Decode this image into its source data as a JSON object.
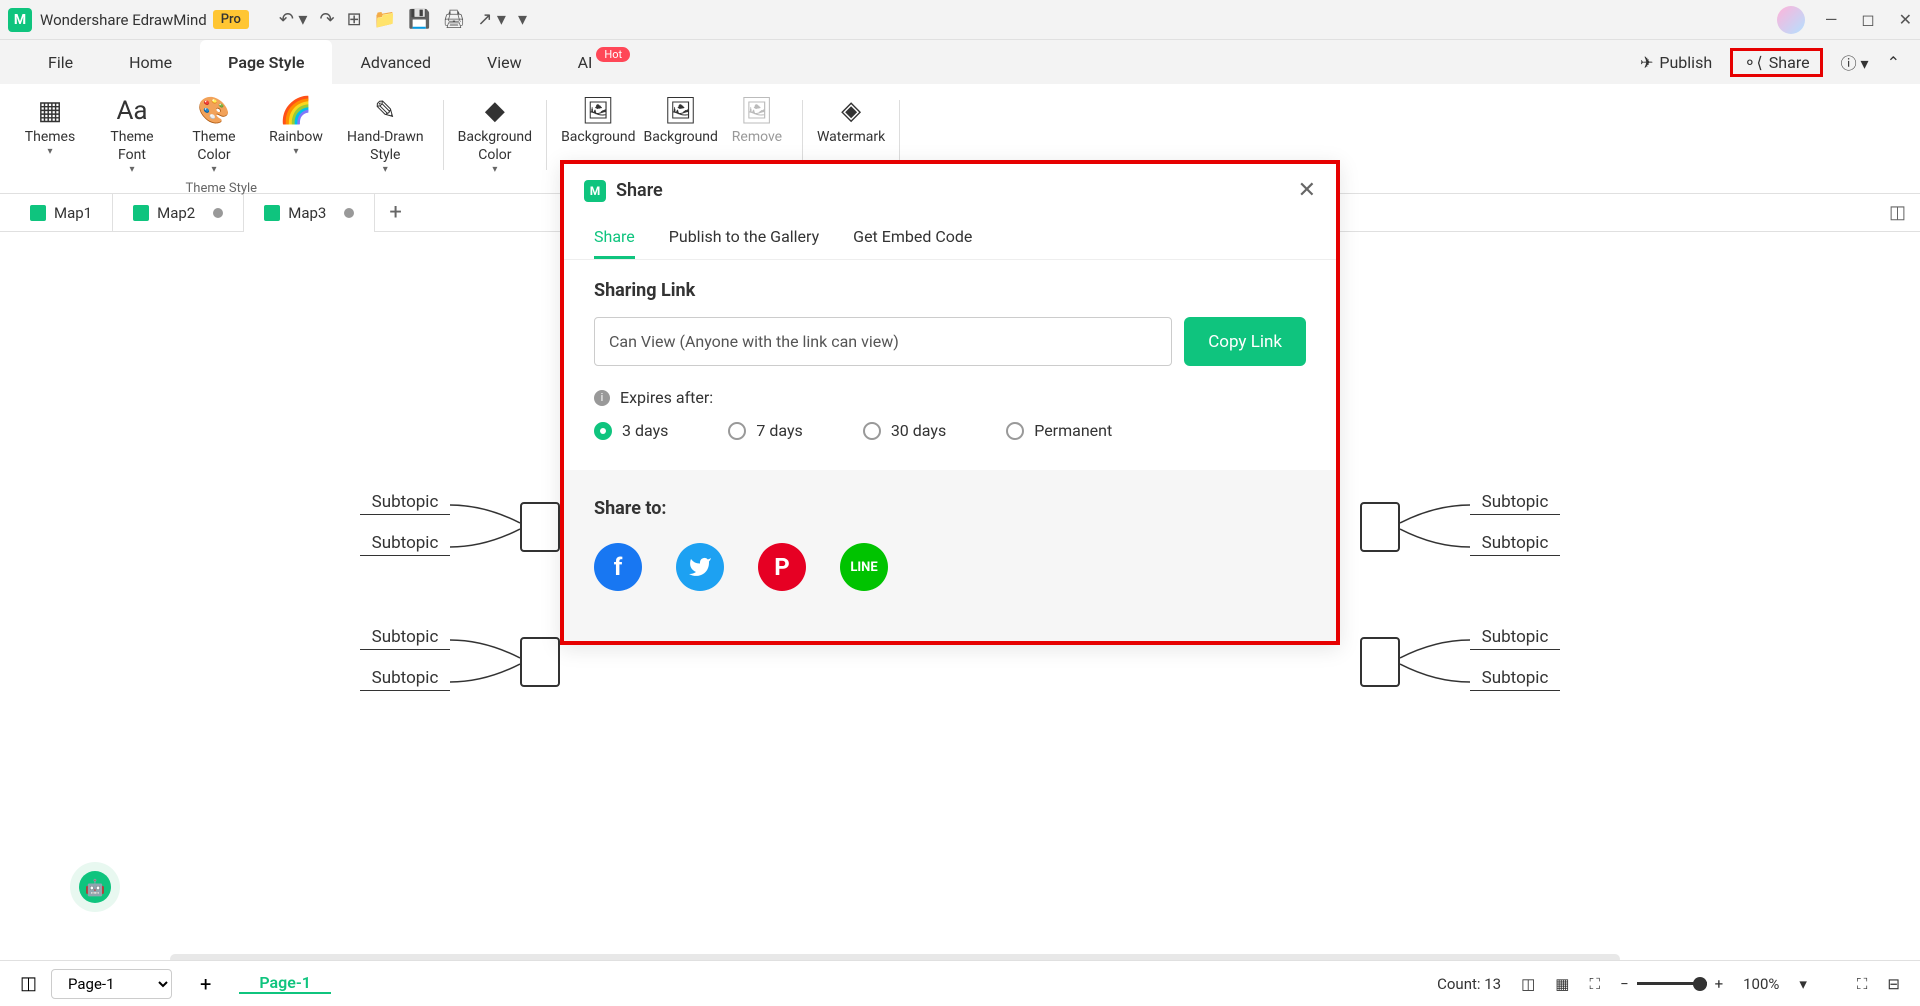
{
  "app": {
    "title": "Wondershare EdrawMind",
    "pro": "Pro"
  },
  "menus": {
    "file": "File",
    "home": "Home",
    "pageStyle": "Page Style",
    "advanced": "Advanced",
    "view": "View",
    "ai": "AI",
    "hot": "Hot",
    "publish": "Publish",
    "share": "Share"
  },
  "ribbon": {
    "themes": "Themes",
    "themeFont": "Theme\nFont",
    "themeColor": "Theme\nColor",
    "rainbow": "Rainbow",
    "handDrawn": "Hand-Drawn\nStyle",
    "groupLabel": "Theme Style",
    "bgColor": "Background\nColor",
    "bg1": "Background",
    "bg2": "Background",
    "remove": "Remove",
    "watermark": "Watermark"
  },
  "tabs": {
    "map1": "Map1",
    "map2": "Map2",
    "map3": "Map3"
  },
  "canvas": {
    "subtopic": "Subtopic"
  },
  "dialog": {
    "title": "Share",
    "tabShare": "Share",
    "tabGallery": "Publish to the Gallery",
    "tabEmbed": "Get Embed Code",
    "sharingLink": "Sharing Link",
    "linkText": "Can View (Anyone with the link can view)",
    "copy": "Copy Link",
    "expires": "Expires after:",
    "d3": "3 days",
    "d7": "7 days",
    "d30": "30 days",
    "perm": "Permanent",
    "shareTo": "Share to:"
  },
  "status": {
    "page": "Page-1",
    "pageActive": "Page-1",
    "count": "Count: 13",
    "zoom": "100%"
  }
}
